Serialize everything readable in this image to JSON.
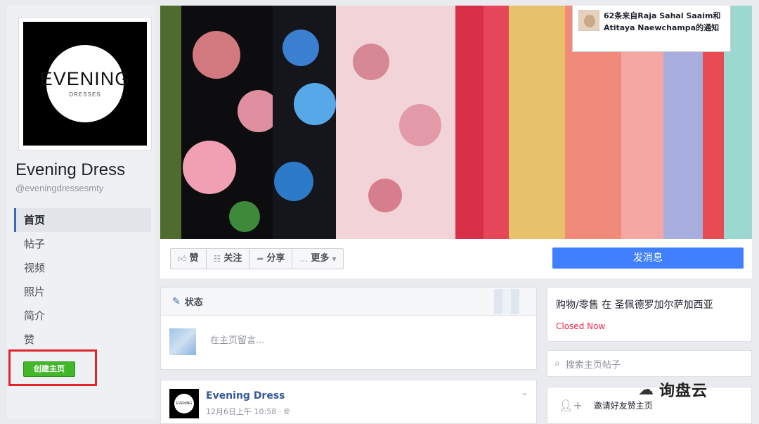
{
  "sidebar": {
    "logo_main": "EVENING",
    "logo_sub": "DRESSES",
    "page_name": "Evening Dress",
    "page_handle": "@eveningdressesmty",
    "nav": [
      {
        "label": "首页",
        "active": true
      },
      {
        "label": "帖子",
        "active": false
      },
      {
        "label": "视频",
        "active": false
      },
      {
        "label": "照片",
        "active": false
      },
      {
        "label": "简介",
        "active": false
      },
      {
        "label": "赞",
        "active": false
      }
    ],
    "create_page_label": "创建主页"
  },
  "cover": {
    "notification_text": "62条来自Raja Sahal Saaim和Atitaya Naewchampa的通知"
  },
  "actions": {
    "like_label": "赞",
    "follow_label": "关注",
    "share_label": "分享",
    "more_label": "更多",
    "message_label": "发消息"
  },
  "composer": {
    "status_label": "状态",
    "placeholder": "在主页留言..."
  },
  "post": {
    "author": "Evening Dress",
    "date": "12月6日上午 10:58 · ",
    "avatar_text": "EVENING"
  },
  "about": {
    "category": "购物/零售 在 圣佩德罗加尔萨加西亚",
    "status": "Closed Now"
  },
  "search": {
    "placeholder": "搜索主页帖子"
  },
  "invite": {
    "label": "邀请好友赞主页"
  },
  "watermark": {
    "text": "询盘云"
  },
  "colors": {
    "accent_blue": "#4080ff",
    "create_green": "#42b72a",
    "highlight_red": "#e0252a",
    "status_red": "#f02849"
  }
}
